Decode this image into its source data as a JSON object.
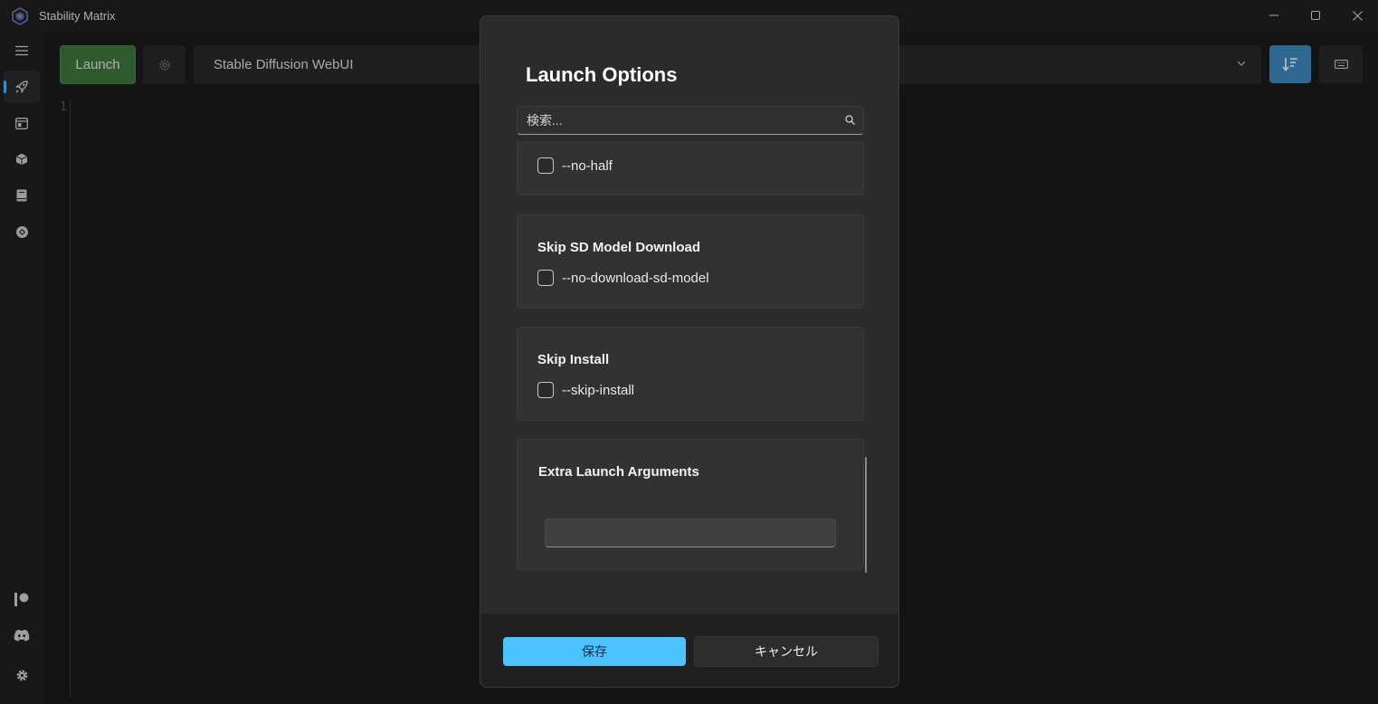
{
  "window": {
    "title": "Stability Matrix",
    "controls": [
      "minimize-icon",
      "maximize-icon",
      "close-icon"
    ]
  },
  "sidebar": {
    "top_items": [
      {
        "icon": "menu-icon"
      },
      {
        "icon": "rocket-icon",
        "active": true
      },
      {
        "icon": "browser-icon"
      },
      {
        "icon": "package-icon"
      },
      {
        "icon": "book-icon"
      },
      {
        "icon": "civitai-icon"
      }
    ],
    "bottom_items": [
      {
        "icon": "patreon-icon"
      },
      {
        "icon": "discord-icon"
      },
      {
        "icon": "gear-icon"
      }
    ]
  },
  "toolbar": {
    "launch_label": "Launch",
    "package_selected": "Stable Diffusion WebUI",
    "accent": "#3c8dbf"
  },
  "console": {
    "line_number": "1"
  },
  "dialog": {
    "title": "Launch Options",
    "search_placeholder": "検索...",
    "options": [
      {
        "title": "",
        "flag": "--no-half"
      },
      {
        "title": "Skip SD Model Download",
        "flag": "--no-download-sd-model"
      },
      {
        "title": "Skip Install",
        "flag": "--skip-install"
      }
    ],
    "extra_args_title": "Extra Launch Arguments",
    "extra_args_value": "",
    "save_label": "保存",
    "cancel_label": "キャンセル",
    "accent": "#4cc2ff"
  }
}
